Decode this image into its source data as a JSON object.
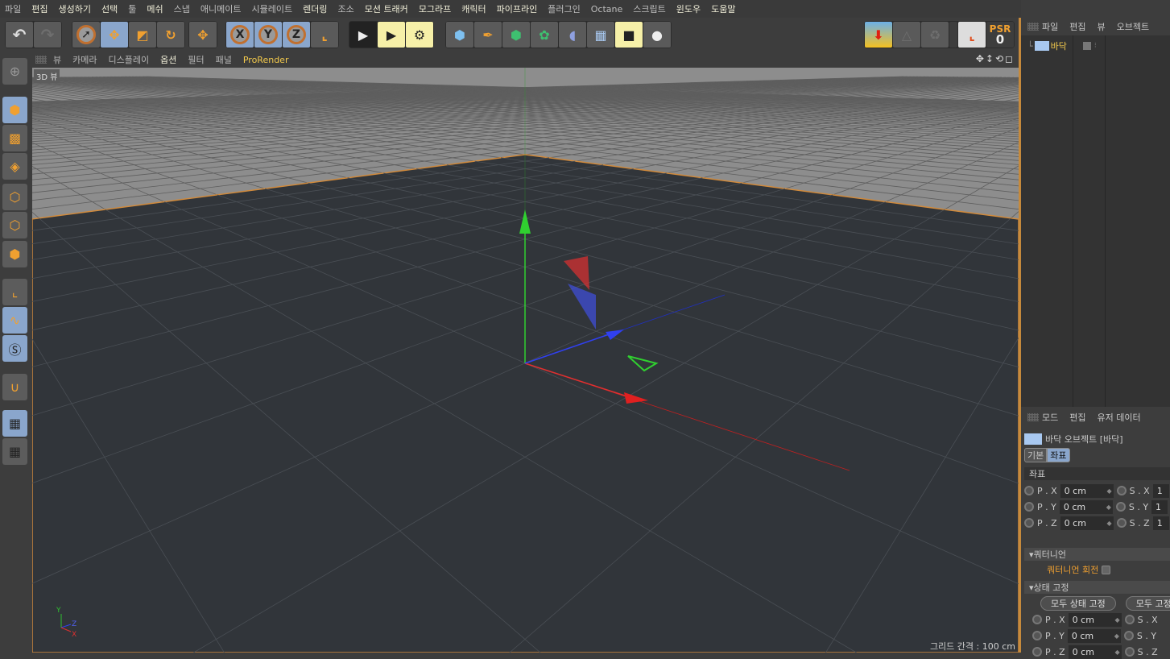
{
  "menubar": {
    "items": [
      "파일",
      "편집",
      "생성하기",
      "선택",
      "툴",
      "메쉬",
      "스냅",
      "애니메이트",
      "시뮬레이트",
      "렌더링",
      "조소",
      "모션 트래커",
      "모그라프",
      "캐릭터",
      "파이프라인",
      "플러그인",
      "Octane",
      "스크립트",
      "윈도우",
      "도움말"
    ]
  },
  "toolbar": {
    "undo": "undo-icon",
    "redo": "redo-icon",
    "groups": [
      [
        "live-selection-icon",
        "move-icon",
        "scale-icon",
        "rotate-icon"
      ],
      [
        "last-tool-icon"
      ],
      [
        "X",
        "Y",
        "Z",
        "world-coordinates-icon"
      ],
      [
        "render-view-icon",
        "render-picture-viewer-icon",
        "render-settings-icon"
      ],
      [
        "cube-icon",
        "pen-spline-icon",
        "subdivision-icon",
        "cloner-icon",
        "deformer-icon",
        "floor-icon",
        "camera-icon",
        "light-icon"
      ]
    ],
    "right": [
      "editable-icon",
      "layout-icon",
      "recycle-icon",
      "axis-icon"
    ],
    "psr_label": "PSR",
    "psr_value": "0"
  },
  "viewport": {
    "menu": [
      "뷰",
      "카메라",
      "디스플레이",
      "옵션",
      "필터",
      "패널",
      "ProRender"
    ],
    "label": "3D 뷰",
    "grid_info": "그리드 간격 : 100 cm",
    "axis_labels": {
      "y": "Y",
      "z": "Z",
      "x": "X"
    }
  },
  "left_toolbar": [
    "make-editable-icon",
    "model-mode-icon",
    "texture-mode-icon",
    "workplane-mode-icon",
    "points-mode-icon",
    "edges-mode-icon",
    "polygons-mode-icon",
    "axis-mode-icon",
    "tweak-mode-icon",
    "solo-icon",
    "snap-icon",
    "lock-workplane-icon",
    "workplane-align-icon"
  ],
  "object_manager": {
    "menu": [
      "파일",
      "편집",
      "뷰",
      "오브젝트"
    ],
    "objects": [
      {
        "name": "바닥"
      }
    ]
  },
  "attribute_manager": {
    "menu": [
      "모드",
      "편집",
      "유저 데이터"
    ],
    "object_title": "바닥 오브젝트 [바닥]",
    "tabs": [
      "기본",
      "좌표"
    ],
    "active_tab": "좌표",
    "section": "좌표",
    "fields": [
      {
        "label": "P . X",
        "value": "0 cm",
        "s_label": "S . X",
        "s_value": "1"
      },
      {
        "label": "P . Y",
        "value": "0 cm",
        "s_label": "S . Y",
        "s_value": "1"
      },
      {
        "label": "P . Z",
        "value": "0 cm",
        "s_label": "S . Z",
        "s_value": "1"
      }
    ],
    "quaternion_section": "쿼터니언",
    "quaternion_rotation": "쿼터니언 회전",
    "freeze_section": "상태 고정",
    "freeze_all": "모두 상태 고정",
    "freeze_all2": "모두 고정",
    "freeze_fields": [
      {
        "label": "P . X",
        "value": "0 cm",
        "s_label": "S . X"
      },
      {
        "label": "P . Y",
        "value": "0 cm",
        "s_label": "S . Y"
      },
      {
        "label": "P . Z",
        "value": "0 cm",
        "s_label": "S . Z"
      }
    ]
  }
}
